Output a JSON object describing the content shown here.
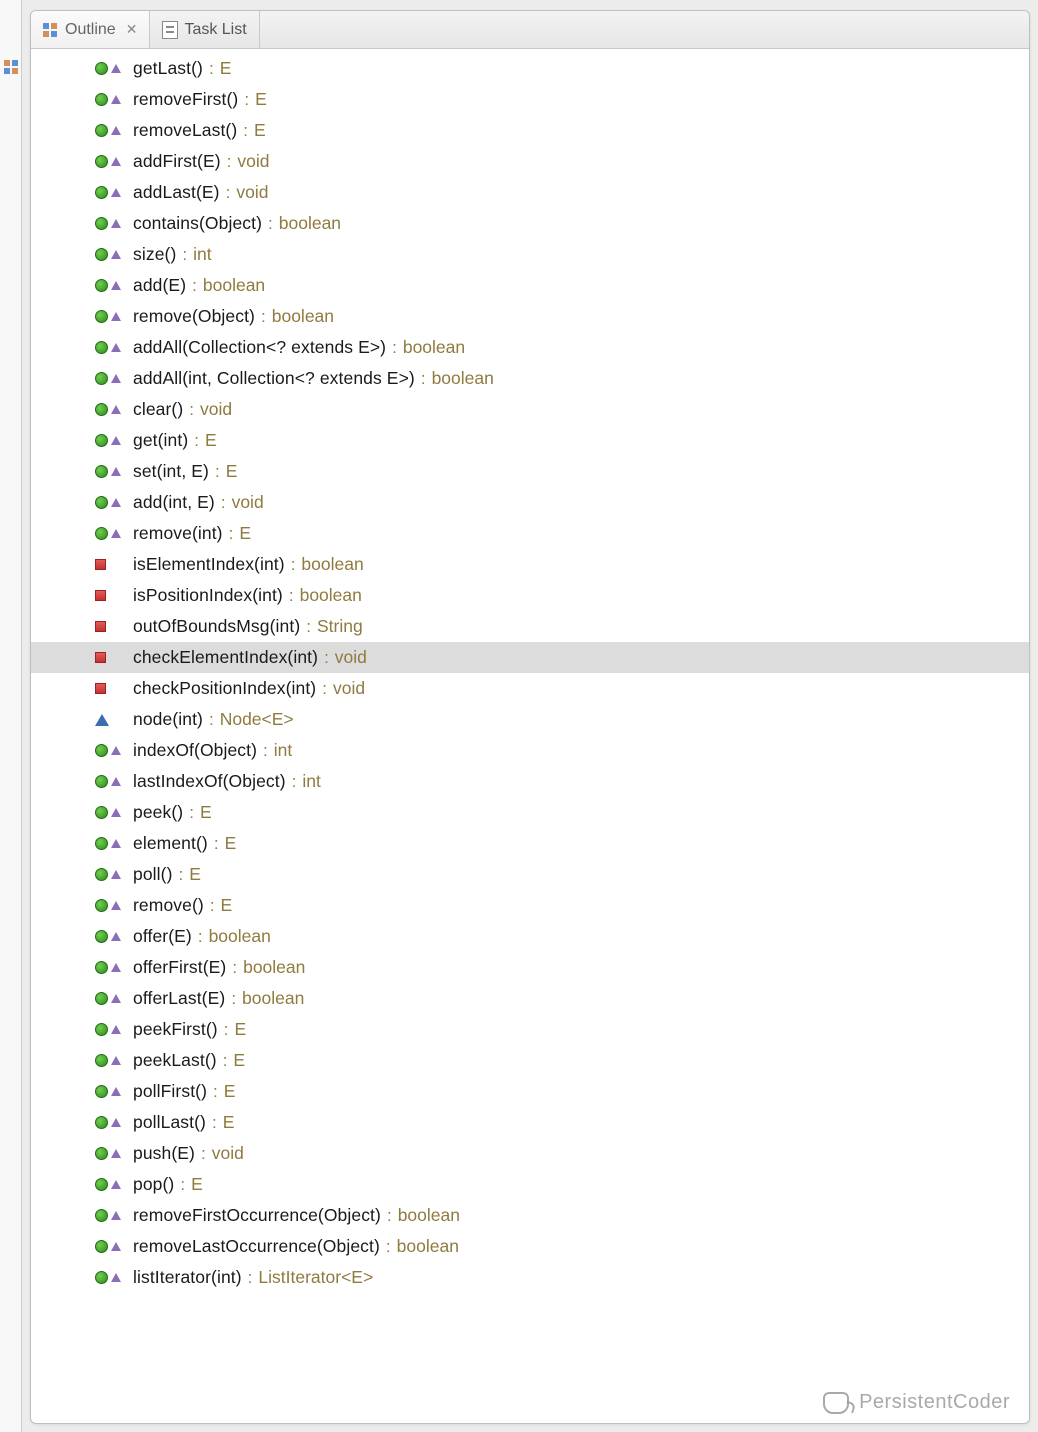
{
  "tabs": [
    {
      "label": "Outline",
      "active": true,
      "icon": "outline-icon"
    },
    {
      "label": "Task List",
      "active": false,
      "icon": "tasklist-icon"
    }
  ],
  "watermark": "PersistentCoder",
  "outline": [
    {
      "vis": "public",
      "override": true,
      "sig": "getLast()",
      "ret": "E"
    },
    {
      "vis": "public",
      "override": true,
      "sig": "removeFirst()",
      "ret": "E"
    },
    {
      "vis": "public",
      "override": true,
      "sig": "removeLast()",
      "ret": "E"
    },
    {
      "vis": "public",
      "override": true,
      "sig": "addFirst(E)",
      "ret": "void"
    },
    {
      "vis": "public",
      "override": true,
      "sig": "addLast(E)",
      "ret": "void"
    },
    {
      "vis": "public",
      "override": true,
      "sig": "contains(Object)",
      "ret": "boolean"
    },
    {
      "vis": "public",
      "override": true,
      "sig": "size()",
      "ret": "int"
    },
    {
      "vis": "public",
      "override": true,
      "sig": "add(E)",
      "ret": "boolean"
    },
    {
      "vis": "public",
      "override": true,
      "sig": "remove(Object)",
      "ret": "boolean"
    },
    {
      "vis": "public",
      "override": true,
      "sig": "addAll(Collection<? extends E>)",
      "ret": "boolean"
    },
    {
      "vis": "public",
      "override": true,
      "sig": "addAll(int, Collection<? extends E>)",
      "ret": "boolean"
    },
    {
      "vis": "public",
      "override": true,
      "sig": "clear()",
      "ret": "void"
    },
    {
      "vis": "public",
      "override": true,
      "sig": "get(int)",
      "ret": "E"
    },
    {
      "vis": "public",
      "override": true,
      "sig": "set(int, E)",
      "ret": "E"
    },
    {
      "vis": "public",
      "override": true,
      "sig": "add(int, E)",
      "ret": "void"
    },
    {
      "vis": "public",
      "override": true,
      "sig": "remove(int)",
      "ret": "E"
    },
    {
      "vis": "private",
      "override": false,
      "sig": "isElementIndex(int)",
      "ret": "boolean"
    },
    {
      "vis": "private",
      "override": false,
      "sig": "isPositionIndex(int)",
      "ret": "boolean"
    },
    {
      "vis": "private",
      "override": false,
      "sig": "outOfBoundsMsg(int)",
      "ret": "String"
    },
    {
      "vis": "private",
      "override": false,
      "sig": "checkElementIndex(int)",
      "ret": "void",
      "selected": true
    },
    {
      "vis": "private",
      "override": false,
      "sig": "checkPositionIndex(int)",
      "ret": "void"
    },
    {
      "vis": "default",
      "override": false,
      "sig": "node(int)",
      "ret": "Node<E>"
    },
    {
      "vis": "public",
      "override": true,
      "sig": "indexOf(Object)",
      "ret": "int"
    },
    {
      "vis": "public",
      "override": true,
      "sig": "lastIndexOf(Object)",
      "ret": "int"
    },
    {
      "vis": "public",
      "override": true,
      "sig": "peek()",
      "ret": "E"
    },
    {
      "vis": "public",
      "override": true,
      "sig": "element()",
      "ret": "E"
    },
    {
      "vis": "public",
      "override": true,
      "sig": "poll()",
      "ret": "E"
    },
    {
      "vis": "public",
      "override": true,
      "sig": "remove()",
      "ret": "E"
    },
    {
      "vis": "public",
      "override": true,
      "sig": "offer(E)",
      "ret": "boolean"
    },
    {
      "vis": "public",
      "override": true,
      "sig": "offerFirst(E)",
      "ret": "boolean"
    },
    {
      "vis": "public",
      "override": true,
      "sig": "offerLast(E)",
      "ret": "boolean"
    },
    {
      "vis": "public",
      "override": true,
      "sig": "peekFirst()",
      "ret": "E"
    },
    {
      "vis": "public",
      "override": true,
      "sig": "peekLast()",
      "ret": "E"
    },
    {
      "vis": "public",
      "override": true,
      "sig": "pollFirst()",
      "ret": "E"
    },
    {
      "vis": "public",
      "override": true,
      "sig": "pollLast()",
      "ret": "E"
    },
    {
      "vis": "public",
      "override": true,
      "sig": "push(E)",
      "ret": "void"
    },
    {
      "vis": "public",
      "override": true,
      "sig": "pop()",
      "ret": "E"
    },
    {
      "vis": "public",
      "override": true,
      "sig": "removeFirstOccurrence(Object)",
      "ret": "boolean"
    },
    {
      "vis": "public",
      "override": true,
      "sig": "removeLastOccurrence(Object)",
      "ret": "boolean"
    },
    {
      "vis": "public",
      "override": true,
      "sig": "listIterator(int)",
      "ret": "ListIterator<E>"
    }
  ]
}
